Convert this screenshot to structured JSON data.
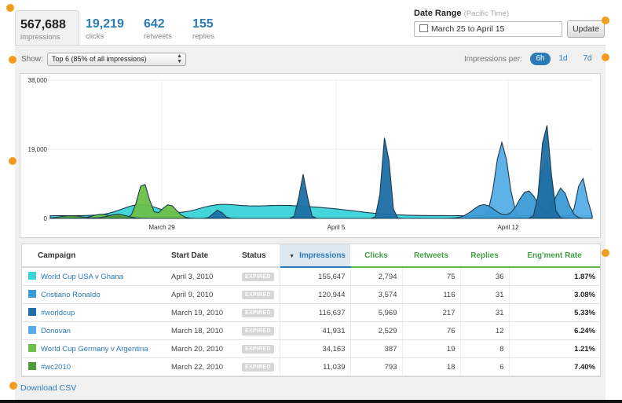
{
  "metrics": [
    {
      "value": "567,688",
      "label": "impressions"
    },
    {
      "value": "19,219",
      "label": "clicks"
    },
    {
      "value": "642",
      "label": "retweets"
    },
    {
      "value": "155",
      "label": "replies"
    }
  ],
  "date_range": {
    "title": "Date Range",
    "timezone": "(Pacific Time)",
    "value": "March 25 to April 15",
    "update_label": "Update"
  },
  "filter": {
    "show_label": "Show:",
    "selected": "Top 6 (85% of all impressions)"
  },
  "impressions_per": {
    "label": "Impressions per:",
    "options": [
      "6h",
      "1d",
      "7d"
    ],
    "active": "6h"
  },
  "chart_data": {
    "type": "area",
    "y_ticks": [
      "38,000",
      "19,000",
      "0"
    ],
    "ylim": [
      0,
      38000
    ],
    "x_ticks": [
      "March 29",
      "April 5",
      "April 12"
    ],
    "grid": true,
    "series": [
      {
        "name": "World Cup USA v Ghana",
        "color": "#39d3d8"
      },
      {
        "name": "Cristiano Ronaldo",
        "color": "#3b9bd6"
      },
      {
        "name": "#worldcup",
        "color": "#1d6fa5"
      },
      {
        "name": "Donovan",
        "color": "#56aee6"
      },
      {
        "name": "World Cup Germany v Argentina",
        "color": "#6cc04a"
      },
      {
        "name": "#wc2010",
        "color": "#4a9e3a"
      }
    ]
  },
  "table": {
    "headers": [
      "Campaign",
      "Start Date",
      "Status",
      "Impressions",
      "Clicks",
      "Retweets",
      "Replies",
      "Eng'ment Rate"
    ],
    "status_text": "EXPIRED",
    "rows": [
      {
        "campaign": "World Cup USA v Ghana",
        "start": "April 3, 2010",
        "impressions": "155,647",
        "clicks": "2,794",
        "retweets": "75",
        "replies": "36",
        "rate": "1.87%",
        "color": "#39d3d8"
      },
      {
        "campaign": "Cristiano Ronaldo",
        "start": "April 9, 2010",
        "impressions": "120,944",
        "clicks": "3,574",
        "retweets": "116",
        "replies": "31",
        "rate": "3.08%",
        "color": "#3b9bd6"
      },
      {
        "campaign": "#worldcup",
        "start": "March 19, 2010",
        "impressions": "116,637",
        "clicks": "5,969",
        "retweets": "217",
        "replies": "31",
        "rate": "5.33%",
        "color": "#1d6fa5"
      },
      {
        "campaign": "Donovan",
        "start": "March 18, 2010",
        "impressions": "41,931",
        "clicks": "2,529",
        "retweets": "76",
        "replies": "12",
        "rate": "6.24%",
        "color": "#56aee6"
      },
      {
        "campaign": "World Cup Germany v Argentina",
        "start": "March 20, 2010",
        "impressions": "34,163",
        "clicks": "387",
        "retweets": "19",
        "replies": "8",
        "rate": "1.21%",
        "color": "#6cc04a"
      },
      {
        "campaign": "#wc2010",
        "start": "March 22, 2010",
        "impressions": "11,039",
        "clicks": "793",
        "retweets": "18",
        "replies": "6",
        "rate": "7.40%",
        "color": "#4a9e3a"
      }
    ]
  },
  "download_label": "Download CSV",
  "colors": {
    "accent": "#2b7bb9",
    "highlight": "#f29b1d",
    "engagement": "#43a047"
  }
}
